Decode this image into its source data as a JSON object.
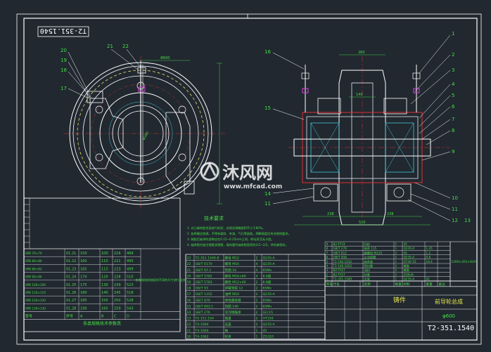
{
  "drawing": {
    "number_top": "T2-351.1540",
    "number_bottom": "T2-351.1540",
    "part_name": "铸件",
    "assembly_title": "前导轮总成",
    "assembly_sub": "φ600"
  },
  "watermark": {
    "brand": "沐风网",
    "url": "www.mfcad.com"
  },
  "front_view_callouts": [
    "20",
    "21",
    "22",
    "19",
    "18",
    "17"
  ],
  "section_view_callouts_left": [
    "16",
    "15",
    "14",
    "11"
  ],
  "section_view_callouts_right": [
    "1",
    "2",
    "3",
    "4",
    "5",
    "6",
    "7",
    "8",
    "9",
    "10",
    "11",
    "12",
    "13"
  ],
  "dimensions": {
    "front_top": "Φ600",
    "front_bore": "Φ280",
    "section_top": "260",
    "section_inner": "140",
    "section_bottom_left": "238",
    "section_bottom_right": "238",
    "section_bottom": "520"
  },
  "tech_requirements": {
    "title": "技术要求",
    "items": [
      "1. 对凸缘的配合面进行检验，应保证接触面积不小于80%。",
      "2. 各焊缝应饱满，不得有裂纹、夹渣、气孔等缺陷，焊脚高度应符合图纸要求。",
      "3. 装配后轴承的游隙应在0.15~0.25mm之间，转动灵活无卡阻。",
      "4. 轴承腔内加注锂基润滑脂，填充量为轴承腔容积的1/2~2/3，并检查密封。"
    ]
  },
  "left_table": {
    "rows": [
      [
        "SPB 70×70",
        "01.21",
        "150",
        "100",
        "216",
        "489"
      ],
      [
        "SPB 80×80",
        "01.22",
        "160",
        "110",
        "221",
        "495"
      ],
      [
        "SPB 80×83",
        "01.23",
        "165",
        "115",
        "223",
        "499"
      ],
      [
        "SPB 90×90",
        "01.24",
        "170",
        "120",
        "228",
        "510"
      ],
      [
        "SPB 100×100",
        "01.25",
        "175",
        "130",
        "239",
        "523"
      ],
      [
        "SPB 110×110",
        "01.26",
        "180",
        "140",
        "245",
        "518"
      ],
      [
        "SPB 120×120",
        "01.27",
        "185",
        "150",
        "250",
        "528"
      ],
      [
        "SPB 130×130",
        "01.28",
        "190",
        "160",
        "259",
        "543"
      ]
    ],
    "footer": [
      "型号",
      "序号",
      "A",
      "B",
      "C",
      "D"
    ],
    "title": "各类规格技术参数表",
    "note": "各规格按照装配时不同的尺寸进行组合"
  },
  "mid_table": {
    "rows": [
      [
        "23",
        "T2-351.1540-8",
        "螺母 M12",
        "2",
        "Q235-A"
      ],
      [
        "22",
        "GB/T 6170",
        "螺母 M16",
        "4",
        "Q235-A"
      ],
      [
        "21",
        "GB/T 97.1",
        "垫圈 16",
        "4",
        "65Mn"
      ],
      [
        "20",
        "GB/T 5782",
        "螺栓 M16×60",
        "4",
        "8.8级"
      ],
      [
        "19",
        "GB/T 5783",
        "螺栓 M12×40",
        "2",
        "8.8级"
      ],
      [
        "18",
        "GB/T 93",
        "弹簧垫圈 12",
        "2",
        "65Mn"
      ],
      [
        "17",
        "GB/T 1152",
        "油杯 M10",
        "2",
        "Q235-A"
      ],
      [
        "16",
        "GB/T 879",
        "弹性圆柱销",
        "2",
        "65Mn"
      ],
      [
        "15",
        "GB/T 893.1",
        "挡圈 140",
        "2",
        "65Mn"
      ],
      [
        "14",
        "GB/T 276",
        "深沟球轴承",
        "2",
        "GCr15"
      ],
      [
        "13",
        "T2-151.154",
        "端盖",
        "2",
        "HT150"
      ],
      [
        "12",
        "T4-1064",
        "压盖",
        "2",
        "Q235-A"
      ],
      [
        "11",
        "T4-1064",
        "轴",
        "1",
        "45"
      ],
      [
        "10",
        "T4-1062",
        "轮体",
        "1",
        "ZG310"
      ]
    ]
  },
  "right_table": {
    "rows": [
      [
        "9",
        "B2-TY74",
        "托轮",
        "1",
        "45",
        "",
        ""
      ],
      [
        "8",
        "GB/T 276",
        "轴承 115",
        "1",
        "Q235-A",
        "1.35",
        ""
      ],
      [
        "7",
        "GB/T 812",
        "圆螺母 M110",
        "2",
        "45",
        "1.2",
        ""
      ],
      [
        "6",
        "GB/T 858",
        "止动垫圈",
        "2",
        "Q235-A",
        "0.8",
        ""
      ],
      [
        "5",
        "T2-146.1032",
        "轴承座",
        "1",
        "QT40-10",
        "18.4",
        ""
      ],
      [
        "4",
        "T2-146.1022",
        "密封圈",
        "2",
        "橡胶",
        "",
        ""
      ],
      [
        "3",
        "B2-TY27",
        "油封",
        "2",
        "橡胶",
        "",
        ""
      ],
      [
        "2",
        "B2-TY27",
        "衬套",
        "2",
        "ZQSn6",
        "",
        ""
      ],
      [
        "1",
        "T2-351.1540",
        "支架",
        "1",
        "Q235-A",
        "92",
        ""
      ]
    ],
    "header": [
      "序号",
      "代号",
      "名称",
      "数量",
      "材料",
      "重量",
      "备注"
    ],
    "side_note": "1200×263×620"
  }
}
